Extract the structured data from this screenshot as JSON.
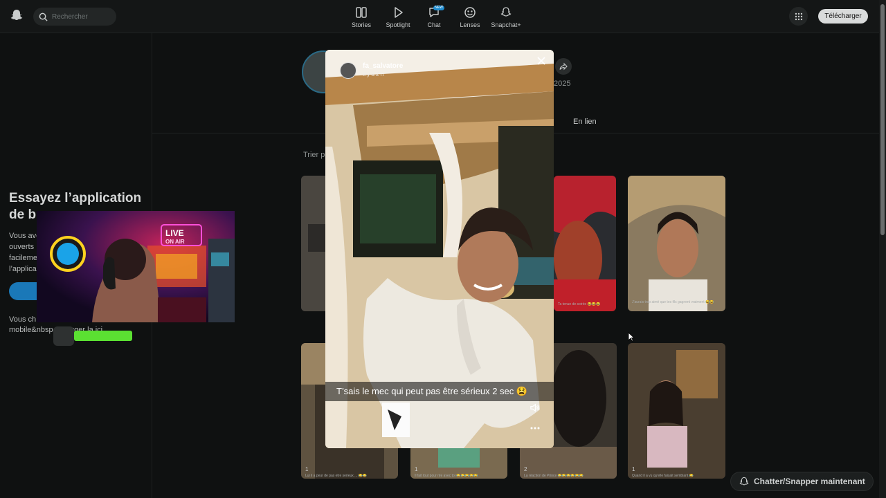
{
  "topbar": {
    "search_placeholder": "Rechercher",
    "nav": [
      {
        "label": "Stories",
        "icon": "stories-icon"
      },
      {
        "label": "Spotlight",
        "icon": "play-icon"
      },
      {
        "label": "Chat",
        "icon": "chat-icon",
        "badge": "NEW"
      },
      {
        "label": "Lenses",
        "icon": "lenses-icon"
      },
      {
        "label": "Snapchat+",
        "icon": "snapchat-plus-icon"
      }
    ],
    "download_label": "Télécharger"
  },
  "left_panel": {
    "title_line1": "Essayez l’application",
    "title_line2": "de b",
    "text_lines": [
      "Vous ave",
      "ouverts",
      "facileme",
      "l’applica"
    ],
    "foot_line1": "Vous ch",
    "foot_line2": "mobile&nbsp   écharger la ici"
  },
  "profile": {
    "date_fragment": "2025",
    "tab_label": "En lien",
    "sort_label": "Trier p"
  },
  "story_viewer": {
    "username": "fa_salvatore",
    "time": "Il y a 2 h",
    "caption": "T’sais le mec qui peut pas être sérieux 2 sec 😫"
  },
  "grid": {
    "tile_counts": [
      "1",
      "1",
      "2",
      "1"
    ],
    "captions": [
      "Lui il a peur de pas etre serieux ... 😂😂",
      "Il fait tout pour rire avec toi 😂😂😂😂😂",
      "La réaction de Prince 😂😂😂😂😂😂",
      "Quand il a vu qu'elle faisait semblant 😂"
    ],
    "top_captions": [
      "Ta tenue de soirée 😂😂😂",
      "J'aurais trop aimé que tes fils gagnent vraiment 😂😂"
    ]
  },
  "chat_button_label": "Chatter/Snapper maintenant",
  "colors": {
    "accent_blue": "#1a78b8",
    "download_bg": "#d9dbdb",
    "green_bar": "#5be032",
    "background": "#0f1111"
  }
}
